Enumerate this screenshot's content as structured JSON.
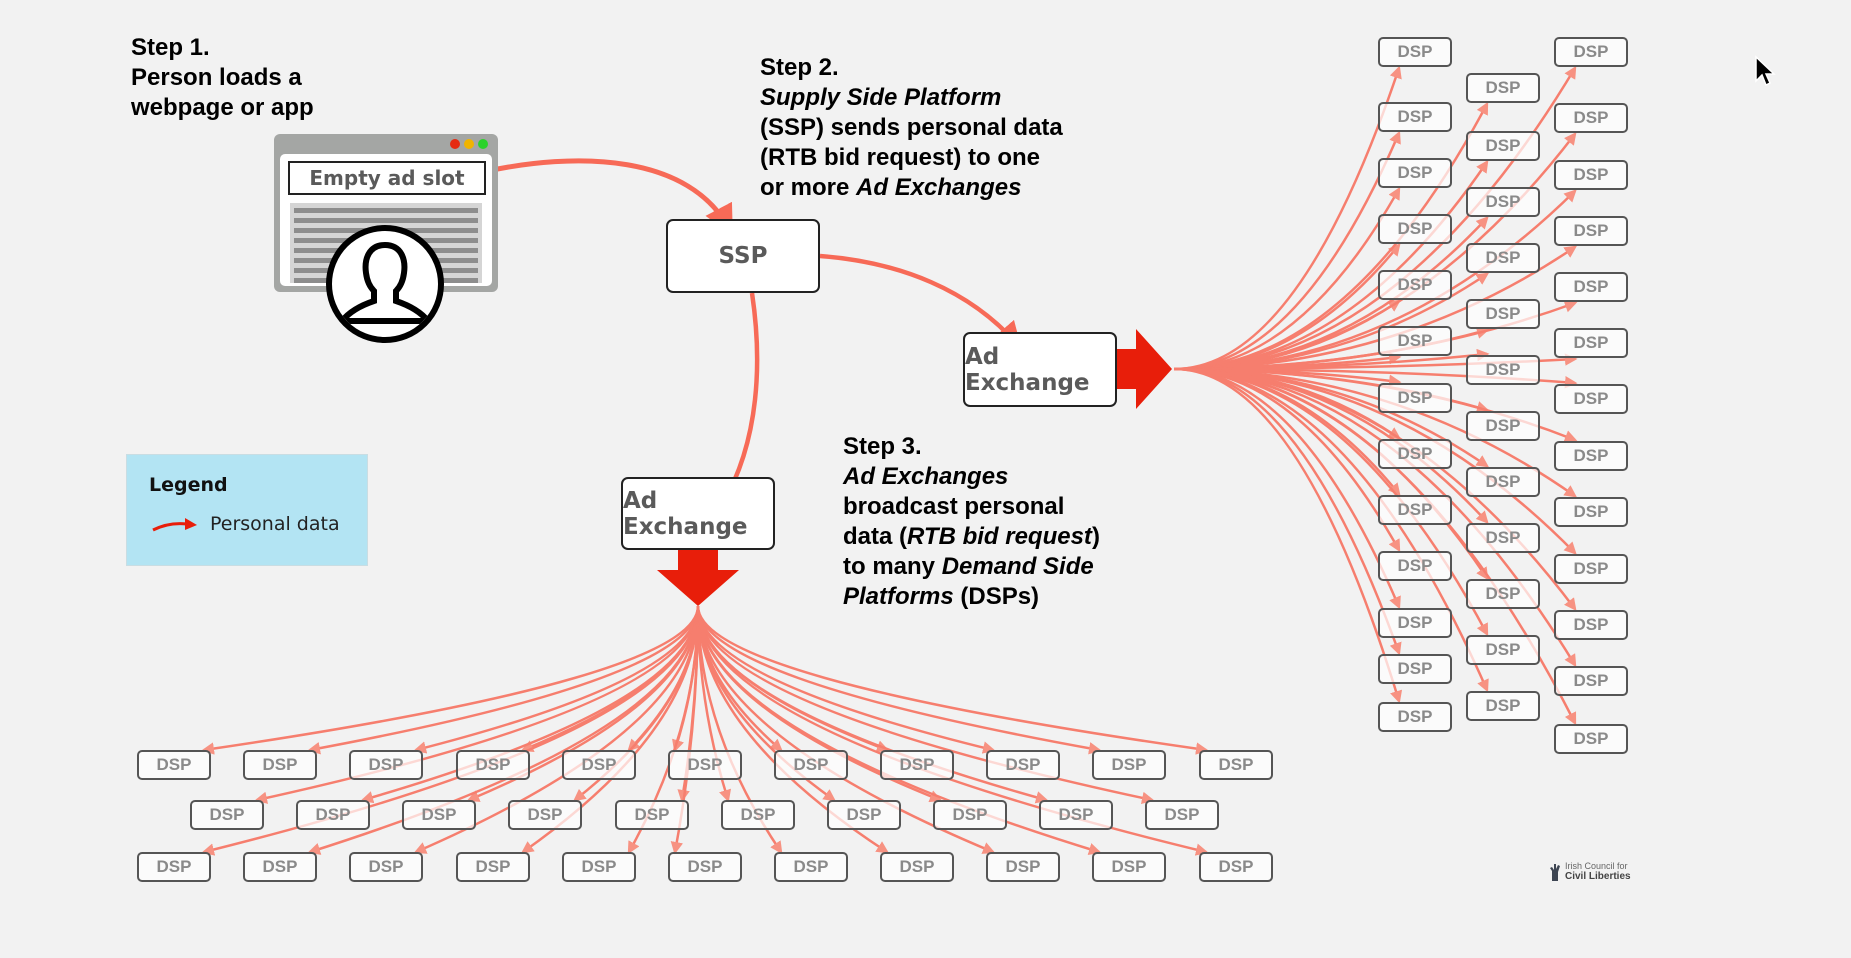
{
  "steps": {
    "step1": [
      "Step 1.",
      "Person loads a",
      "webpage or app"
    ],
    "step2": {
      "heading": "Step 2.",
      "line1_italic": "Supply Side Platform",
      "line2": "(SSP) sends personal data",
      "line3": "(RTB bid request) to one",
      "line4_plain": "or more ",
      "line4_italic": "Ad Exchanges"
    },
    "step3": {
      "heading": "Step 3.",
      "line1_italic": "Ad Exchanges",
      "line2": "broadcast personal",
      "line3_a": "data (",
      "line3_italic": "RTB bid request",
      "line3_b": ")",
      "line4_plain": "to many ",
      "line4_italic": "Demand Side",
      "line5_italic": "Platforms",
      "line5_plain": " (DSPs)"
    }
  },
  "browser": {
    "ad_slot_label": "Empty ad slot",
    "window_dots": [
      "#e52b12",
      "#f0b400",
      "#2bd22b"
    ]
  },
  "nodes": {
    "ssp": "SSP",
    "ad_exchange_right": "Ad Exchange",
    "ad_exchange_bottom": "Ad Exchange",
    "dsp_label": "DSP",
    "dsp_count_right": 38,
    "dsp_count_bottom": 33
  },
  "legend": {
    "title": "Legend",
    "items": [
      {
        "label": "Personal data",
        "icon": "curved-red-arrow-icon"
      }
    ]
  },
  "colors": {
    "data_flow": "#f76a57",
    "broadcast_arrow": "#e81e0a",
    "legend_bg": "#b3e4f3",
    "background": "#f2f2f2"
  },
  "logo": {
    "line1": "Irish Council for",
    "line2": "Civil Liberties"
  }
}
